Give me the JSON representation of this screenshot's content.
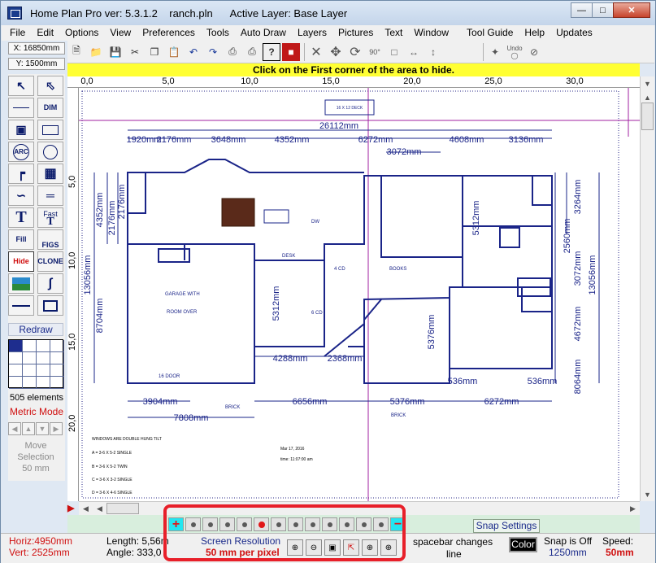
{
  "window": {
    "title": "Home Plan Pro ver: 5.3.1.2    ranch.pln      Active Layer: Base Layer",
    "controls": [
      "minimize-icon",
      "maximize-icon",
      "close-icon"
    ]
  },
  "menu": [
    "File",
    "Edit",
    "Options",
    "View",
    "Preferences",
    "Tools",
    "Auto Draw",
    "Layers",
    "Pictures",
    "Text",
    "Window",
    "Tool Guide",
    "Help",
    "Updates"
  ],
  "coords": {
    "x": "X: 16850mm",
    "y": "Y: 1500mm"
  },
  "toolbar": {
    "icons": [
      "new-file-icon",
      "open-folder-icon",
      "save-icon",
      "cut-icon",
      "copy-icon",
      "paste-icon",
      "undo-icon",
      "redo-icon",
      "print-preview-icon",
      "print-icon",
      "help-icon",
      "exit-icon",
      "delete-x-icon",
      "move-icon",
      "rotate-icon",
      "rotate-90-icon",
      "stretch-icon",
      "flip-horizontal-icon",
      "flip-vertical-icon",
      "magic-wand-icon",
      "undo-delete-icon",
      "no-select-icon"
    ],
    "labels": {
      "undo_small": "Undo"
    }
  },
  "hint": "Click on the First corner of the area to hide.",
  "ruler": {
    "top": [
      "0,0",
      "5,0",
      "10,0",
      "15,0",
      "20,0",
      "25,0",
      "30,0"
    ],
    "left": [
      "5,0",
      "10,0",
      "15,0",
      "20,0"
    ]
  },
  "palette": {
    "tools": [
      {
        "name": "select-arrow-icon",
        "label": ""
      },
      {
        "name": "select-box-icon",
        "label": ""
      },
      {
        "name": "line-icon",
        "label": ""
      },
      {
        "name": "dimension-icon",
        "label": "DIM"
      },
      {
        "name": "polygon-icon",
        "label": ""
      },
      {
        "name": "rectangle-icon",
        "label": ""
      },
      {
        "name": "arc-icon",
        "label": "ARC"
      },
      {
        "name": "circle-icon",
        "label": ""
      },
      {
        "name": "wall-icon",
        "label": ""
      },
      {
        "name": "window-icon",
        "label": ""
      },
      {
        "name": "curve-line-icon",
        "label": ""
      },
      {
        "name": "double-line-icon",
        "label": ""
      },
      {
        "name": "text-icon",
        "label": "T"
      },
      {
        "name": "fast-text-icon",
        "label": "Fast"
      },
      {
        "name": "fill-icon",
        "label": "Fill"
      },
      {
        "name": "figures-icon",
        "label": "FIGS"
      },
      {
        "name": "hide-icon",
        "label": "Hide"
      },
      {
        "name": "clone-icon",
        "label": "CLONE"
      },
      {
        "name": "picture-icon",
        "label": ""
      },
      {
        "name": "freehand-icon",
        "label": ""
      },
      {
        "name": "thin-line-icon",
        "label": ""
      },
      {
        "name": "frame-icon",
        "label": ""
      }
    ],
    "redraw": "Redraw",
    "elements": "505 elements",
    "mode": "Metric Mode",
    "move_selection": [
      "Move",
      "Selection",
      "50 mm"
    ]
  },
  "plan": {
    "dimensions": [
      "26112mm",
      "1920mm",
      "2176mm",
      "3648mm",
      "4352mm",
      "6272mm",
      "4608mm",
      "3136mm",
      "3072mm",
      "4352mm",
      "2176mm",
      "2176mm",
      "13056mm",
      "8704mm",
      "5312mm",
      "3264mm",
      "2560mm",
      "3072mm",
      "13056mm",
      "5312mm",
      "5376mm",
      "4672mm",
      "4288mm",
      "2368mm",
      "536mm",
      "536mm",
      "8064mm",
      "3904mm",
      "7808mm",
      "6656mm",
      "5376mm",
      "6272mm"
    ],
    "labels": {
      "deck": "16 X 12 DECK",
      "garage1": "GARAGE WITH",
      "garage2": "ROOM OVER",
      "door": "16 DOOR",
      "brick1": "BRICK",
      "brick2": "BRICK",
      "desk": "DESK",
      "books": "BOOKS",
      "cd4": "4 CD",
      "cd6": "6 CD",
      "dw": "DW",
      "notes": [
        "WINDOWS ARE DOUBLE HUNG TILT",
        "A = 3-6 X 5-2 SINGLE",
        "B = 3-6 X 5-2 TWIN",
        "C = 3-6 X 3-2 SINGLE",
        "D = 3-6 X 4-6 SINGLE"
      ],
      "date": "Mar 17, 2016",
      "time": "time: 11:07:00 am"
    }
  },
  "zoombar": {
    "snap_settings": "Snap Settings",
    "dots": 12,
    "active_dot": 4
  },
  "status": {
    "horiz": "Horiz:4950mm",
    "vert": "Vert: 2525mm",
    "length": "Length: 5,56m",
    "angle": "Angle:  333,0",
    "screen_res": "Screen Resolution",
    "per_pixel": "50 mm per pixel",
    "spacebar": "spacebar changes",
    "spacebar2": "line",
    "color": "Color",
    "snap": "Snap is Off",
    "snap_val": "1250mm",
    "speed": "Speed:",
    "speed_val": "50mm"
  },
  "colors": {
    "plan_line": "#1a2488",
    "accent_red": "#e01818",
    "hint_bg": "#ffff33"
  }
}
